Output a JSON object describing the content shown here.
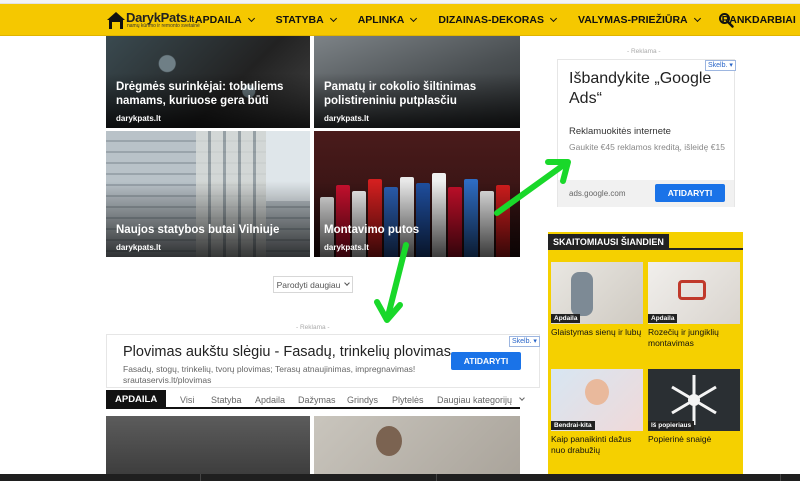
{
  "logo": {
    "name": "DarykPats",
    "tld": ".lt",
    "tagline": "namų kūrimo ir remonto svetainė"
  },
  "nav": [
    {
      "label": "APDAILA"
    },
    {
      "label": "STATYBA"
    },
    {
      "label": "APLINKA"
    },
    {
      "label": "DIZAINAS-DEKORAS"
    },
    {
      "label": "VALYMAS-PRIEŽIŪRA"
    },
    {
      "label": "RANKDARBIAI"
    }
  ],
  "tiles": [
    {
      "title": "Drėgmės surinkėjai: tobuliems namams, kuriuose gera būti",
      "source": "darykpats.lt"
    },
    {
      "title": "Pamatų ir cokolio šiltinimas polistireniniu putplasčiu",
      "source": "darykpats.lt"
    },
    {
      "title": "Naujos statybos butai Vilniuje",
      "source": "darykpats.lt"
    },
    {
      "title": "Montavimo putos",
      "source": "darykpats.lt"
    }
  ],
  "show_more": "Parodyti daugiau",
  "ad_label": "- Reklama -",
  "ad_choice": "Skelb.",
  "ad_wide": {
    "title": "Plovimas aukštu slėgiu - Fasadų, trinkelių plovimas",
    "desc": "Fasadų, stogų, trinkelių, tvorų plovimas; Terasų atnaujinimas, impregnavimas! srautaservis.lt/plovimas",
    "button": "ATIDARYTI"
  },
  "category_bar": {
    "active": "APDAILA",
    "tabs": [
      "Visi",
      "Statyba",
      "Apdaila",
      "Dažymas",
      "Grindys",
      "Plytelės",
      "Daugiau kategorijų"
    ]
  },
  "ad_side": {
    "title": "Išbandykite „Google Ads“",
    "subtitle": "Reklamuokitės internete",
    "desc": "Gaukite €45 reklamos kreditą, išleidę €15",
    "url": "ads.google.com",
    "button": "ATIDARYTI"
  },
  "trending": {
    "title": "SKAITOMIAUSI ŠIANDIEN",
    "items": [
      {
        "badge": "Apdaila",
        "caption": "Glaistymas sienų ir lubų"
      },
      {
        "badge": "Apdaila",
        "caption": "Rozečių ir jungiklių montavimas"
      },
      {
        "badge": "Bendrai-kita",
        "caption": "Kaip panaikinti dažus nuo drabužių"
      },
      {
        "badge": "Iš popieriaus",
        "caption": "Popierinė snaigė"
      }
    ]
  },
  "colors": {
    "brand_yellow": "#f5c800",
    "button_blue": "#1a73e8",
    "arrow_green": "#19d82a"
  },
  "icons": {
    "search": "search-icon",
    "chevron": "chevron-down-icon"
  }
}
